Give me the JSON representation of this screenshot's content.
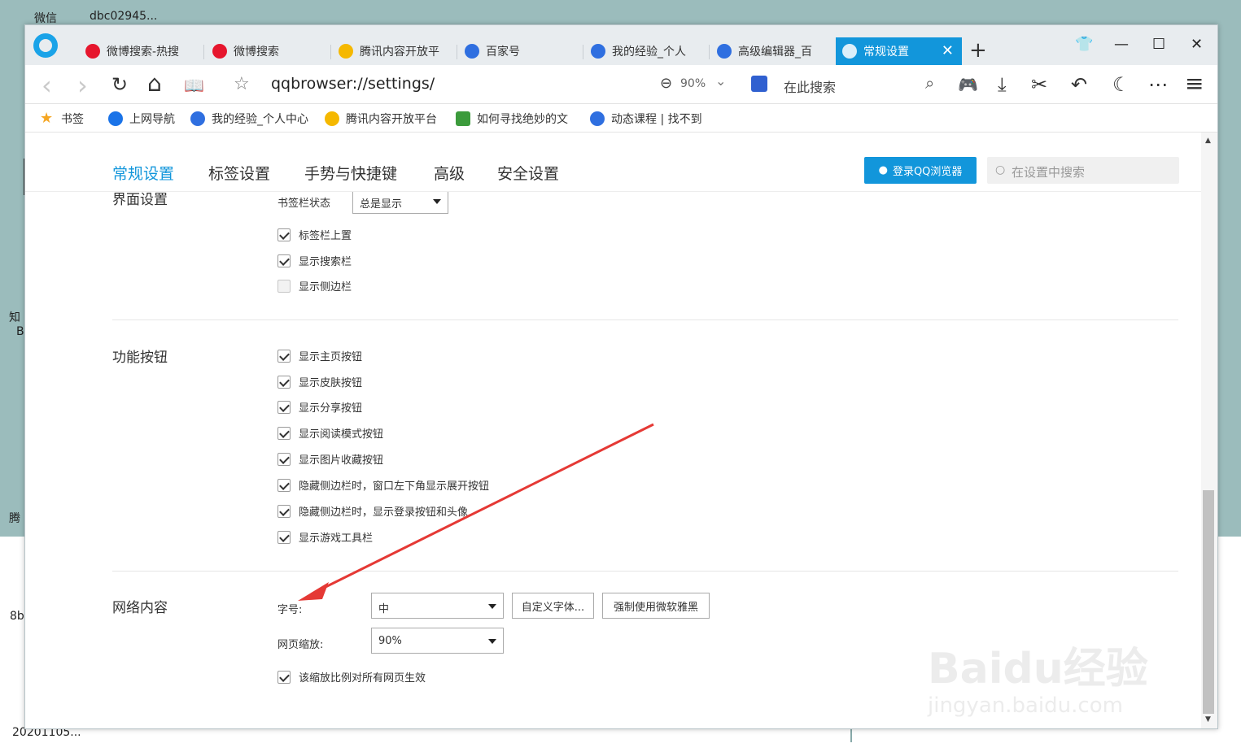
{
  "desktop": {
    "icons": [
      "微信",
      "dbc02945...",
      "知",
      "B",
      "腾",
      "8b",
      "20201105..."
    ]
  },
  "tabs": [
    {
      "label": "微博搜索-热搜",
      "icon": "weibo-icon"
    },
    {
      "label": "微博搜索",
      "icon": "weibo-icon"
    },
    {
      "label": "腾讯内容开放平",
      "icon": "penguin-icon"
    },
    {
      "label": "百家号",
      "icon": "baidu-paw-icon"
    },
    {
      "label": "我的经验_个人",
      "icon": "baidu-paw-icon"
    },
    {
      "label": "高级编辑器_百",
      "icon": "baidu-paw-icon"
    },
    {
      "label": "常规设置",
      "icon": "settings-icon",
      "close": "✕"
    }
  ],
  "window_controls": {
    "skin": "👕",
    "minimize": "—",
    "maximize": "☐",
    "close": "✕",
    "new_tab": "+"
  },
  "navbar": {
    "back": "‹",
    "forward": "›",
    "reload": "↻",
    "home": "⌂",
    "reader": "📖",
    "star": "☆",
    "url": "qqbrowser://settings/",
    "zoom": "90%",
    "zoom_chevron": "⌄",
    "search_placeholder": "在此搜索",
    "search_icon": "⌕",
    "game": "🎮",
    "download": "⤓",
    "cut": "✂",
    "undo": "↶",
    "night": "☾",
    "more": "⋯",
    "menu": "≡"
  },
  "bookmarks": [
    {
      "label": "书签",
      "icon": "star-icon"
    },
    {
      "label": "上网导航",
      "icon": "ie-icon"
    },
    {
      "label": "我的经验_个人中心",
      "icon": "baidu-paw-icon"
    },
    {
      "label": "腾讯内容开放平台",
      "icon": "penguin-icon"
    },
    {
      "label": "如何寻找绝妙的文",
      "icon": "guan-icon"
    },
    {
      "label": "动态课程 | 找不到",
      "icon": "baidu-paw-icon"
    }
  ],
  "settings_nav": {
    "tabs": [
      "常规设置",
      "标签设置",
      "手势与快捷键",
      "高级",
      "安全设置"
    ],
    "login": "登录QQ浏览器",
    "search_placeholder": "在设置中搜索"
  },
  "sections": {
    "interface": {
      "title": "界面设置",
      "bookmark_bar_label": "书签栏状态",
      "bookmark_bar_value": "总是显示",
      "options": [
        {
          "label": "标签栏上置",
          "checked": true
        },
        {
          "label": "显示搜索栏",
          "checked": true
        },
        {
          "label": "显示侧边栏",
          "checked": false
        }
      ]
    },
    "buttons": {
      "title": "功能按钮",
      "options": [
        {
          "label": "显示主页按钮",
          "checked": true
        },
        {
          "label": "显示皮肤按钮",
          "checked": true
        },
        {
          "label": "显示分享按钮",
          "checked": true
        },
        {
          "label": "显示阅读模式按钮",
          "checked": true
        },
        {
          "label": "显示图片收藏按钮",
          "checked": true
        },
        {
          "label": "隐藏侧边栏时，窗口左下角显示展开按钮",
          "checked": true
        },
        {
          "label": "隐藏侧边栏时，显示登录按钮和头像",
          "checked": true
        },
        {
          "label": "显示游戏工具栏",
          "checked": true
        }
      ]
    },
    "web": {
      "title": "网络内容",
      "font_size_label": "字号:",
      "font_size_value": "中",
      "custom_font": "自定义字体...",
      "force_yahei": "强制使用微软雅黑",
      "zoom_label": "网页缩放:",
      "zoom_value": "90%",
      "apply_all": {
        "label": "该缩放比例对所有网页生效",
        "checked": true
      }
    }
  },
  "watermark": {
    "main": "Baidu经验",
    "sub": "jingyan.baidu.com"
  },
  "colors": {
    "accent": "#1296db",
    "arrow": "#e53935"
  }
}
